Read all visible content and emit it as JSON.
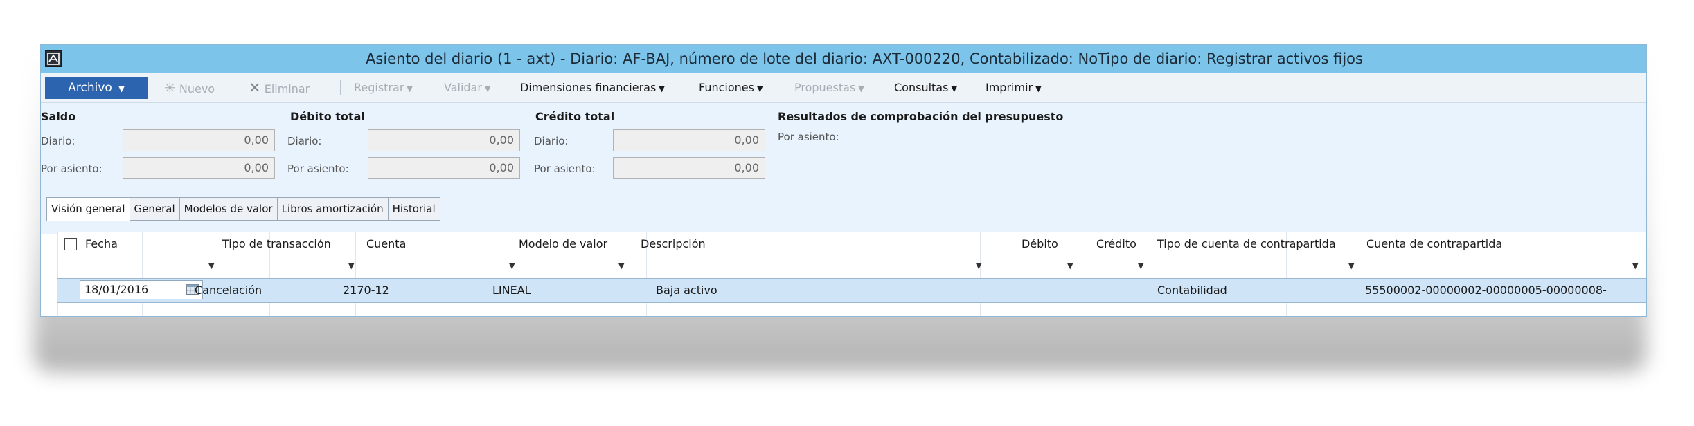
{
  "window": {
    "title": "Asiento del diario (1 - axt) - Diario: AF-BAJ, número de lote del diario: AXT-000220, Contabilizado: NoTipo de diario: Registrar activos fijos"
  },
  "toolbar": {
    "archivo": "Archivo",
    "nuevo": "Nuevo",
    "eliminar": "Eliminar",
    "registrar": "Registrar",
    "validar": "Validar",
    "dimensiones": "Dimensiones financieras",
    "funciones": "Funciones",
    "propuestas": "Propuestas",
    "consultas": "Consultas",
    "imprimir": "Imprimir"
  },
  "summary": {
    "saldo": {
      "title": "Saldo",
      "diario_label": "Diario:",
      "diario_value": "0,00",
      "asiento_label": "Por asiento:",
      "asiento_value": "0,00"
    },
    "debito": {
      "title": "Débito total",
      "diario_label": "Diario:",
      "diario_value": "0,00",
      "asiento_label": "Por asiento:",
      "asiento_value": "0,00"
    },
    "credito": {
      "title": "Crédito total",
      "diario_label": "Diario:",
      "diario_value": "0,00",
      "asiento_label": "Por asiento:",
      "asiento_value": "0,00"
    },
    "presupuesto": {
      "title": "Resultados de comprobación del presupuesto",
      "asiento_label": "Por asiento:"
    }
  },
  "tabs": [
    "Visión general",
    "General",
    "Modelos de valor",
    "Libros amortización",
    "Historial"
  ],
  "grid": {
    "columns": [
      "Fecha",
      "Tipo de transacción",
      "Cuenta",
      "Modelo de valor",
      "Descripción",
      "Débito",
      "Crédito",
      "Tipo de cuenta de contrapartida",
      "Cuenta de contrapartida"
    ],
    "rows": [
      {
        "fecha": "18/01/2016",
        "tipo": "Cancelación",
        "cuenta": "2170-12",
        "modelo": "LINEAL",
        "descripcion": "Baja activo",
        "debito": "",
        "credito": "",
        "tipo_contrapartida": "Contabilidad",
        "cuenta_contrapartida": "55500002-00000002-00000005-00000008-"
      }
    ]
  },
  "colors": {
    "titlebar": "#7cc4ea",
    "archivo_button": "#2d64b0",
    "summary_bg": "#e8f3fd",
    "selected_row": "#cfe4f6"
  }
}
